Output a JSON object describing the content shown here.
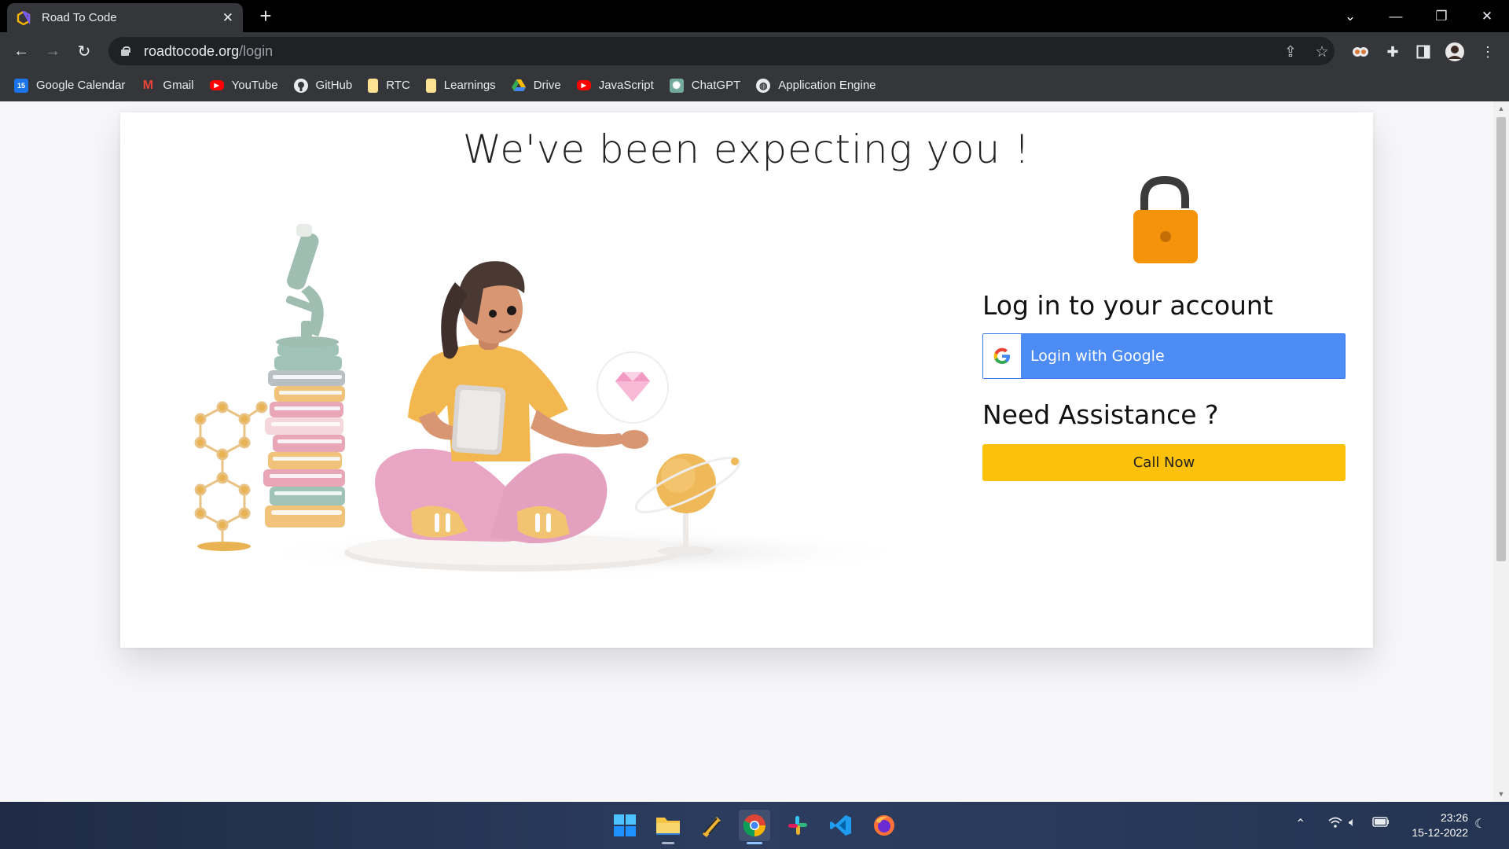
{
  "browser": {
    "tab_title": "Road To Code",
    "tab_close": "✕",
    "new_tab": "+",
    "url_host": "roadtocode.org",
    "url_path": "/login"
  },
  "bookmarks": [
    {
      "label": "Google Calendar",
      "icon": "calendar-icon",
      "color": "#1a73e8",
      "glyph": "15"
    },
    {
      "label": "Gmail",
      "icon": "gmail-icon",
      "color": "#ea4335",
      "glyph": "M"
    },
    {
      "label": "YouTube",
      "icon": "youtube-icon",
      "color": "#ff0000",
      "glyph": "▶"
    },
    {
      "label": "GitHub",
      "icon": "github-icon",
      "color": "#e8eaed",
      "glyph": "●"
    },
    {
      "label": "RTC",
      "icon": "folder-icon",
      "color": "#fde293",
      "glyph": ""
    },
    {
      "label": "Learnings",
      "icon": "folder-icon",
      "color": "#fde293",
      "glyph": ""
    },
    {
      "label": "Drive",
      "icon": "drive-icon",
      "color": "#34a853",
      "glyph": "▲"
    },
    {
      "label": "JavaScript",
      "icon": "youtube-icon",
      "color": "#ff0000",
      "glyph": "▶"
    },
    {
      "label": "ChatGPT",
      "icon": "chatgpt-icon",
      "color": "#74aa9c",
      "glyph": "✺"
    },
    {
      "label": "Application Engine",
      "icon": "globe-icon",
      "color": "#e8eaed",
      "glyph": "◍"
    }
  ],
  "page": {
    "headline": "We've been expecting you !",
    "login_title": "Log in to your account",
    "google_button": "Login with Google",
    "assist_title": "Need Assistance ?",
    "call_button": "Call Now"
  },
  "colors": {
    "google_blue": "#4d8cf5",
    "call_yellow": "#fcc10a",
    "lock_orange": "#f5930b"
  },
  "taskbar": {
    "time": "23:26",
    "date": "15-12-2022"
  }
}
